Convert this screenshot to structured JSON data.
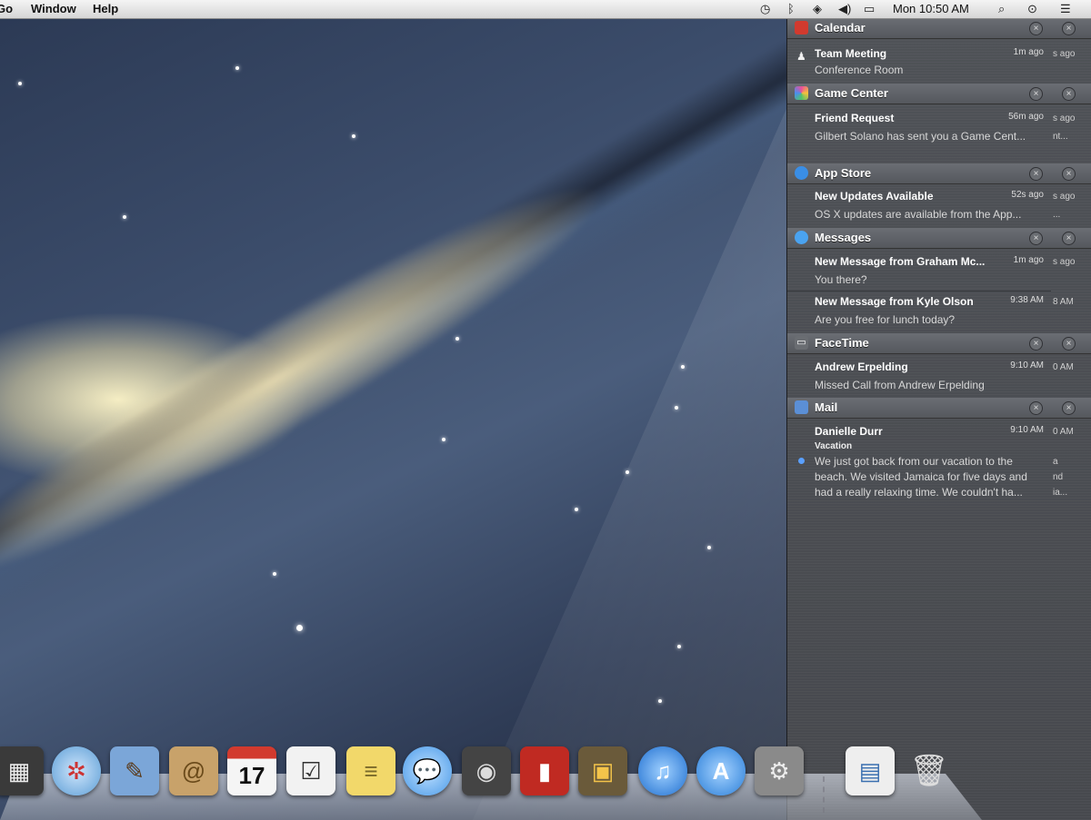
{
  "menubar": {
    "items": [
      "Go",
      "Window",
      "Help"
    ],
    "status_icons": [
      "time-machine-icon",
      "bluetooth-icon",
      "wifi-icon",
      "volume-icon",
      "battery-icon"
    ],
    "clock": "Mon 10:50 AM",
    "right_icons": [
      "spotlight-icon",
      "user-icon",
      "notification-center-icon"
    ]
  },
  "notification_center": {
    "groups": [
      {
        "app": "Calendar",
        "icon": "calendar-icon",
        "icon_color": "#d23a2e",
        "items": [
          {
            "title": "Team Meeting",
            "time": "1m ago",
            "line": "Conference Room",
            "ghost_time": "s ago"
          }
        ]
      },
      {
        "app": "Game Center",
        "icon": "game-center-icon",
        "icon_color": "#e84f9a",
        "items": [
          {
            "title": "Friend Request",
            "time": "56m ago",
            "line": "Gilbert Solano has sent you a Game Cent...",
            "ghost_time": "s ago",
            "ghost_line": "nt..."
          }
        ]
      },
      {
        "app": "App Store",
        "icon": "app-store-icon",
        "icon_color": "#3a8ee6",
        "items": [
          {
            "title": "New Updates Available",
            "time": "52s ago",
            "line": "OS X updates are available from the App...",
            "ghost_time": "s ago",
            "ghost_line": "..."
          }
        ]
      },
      {
        "app": "Messages",
        "icon": "messages-icon",
        "icon_color": "#4aa3f0",
        "items": [
          {
            "title": "New Message from Graham Mc...",
            "time": "1m ago",
            "line": "You there?",
            "ghost_time": "s ago"
          },
          {
            "title": "New Message from Kyle Olson",
            "time": "9:38 AM",
            "line": "Are you free for lunch today?",
            "ghost_time": "8 AM"
          }
        ]
      },
      {
        "app": "FaceTime",
        "icon": "facetime-icon",
        "icon_color": "#6a6d72",
        "items": [
          {
            "title": "Andrew Erpelding",
            "time": "9:10 AM",
            "line": "Missed Call from Andrew Erpelding",
            "ghost_time": "0 AM"
          }
        ]
      },
      {
        "app": "Mail",
        "icon": "mail-icon",
        "icon_color": "#5b8fd6",
        "items": [
          {
            "title": "Danielle Durr",
            "time": "9:10 AM",
            "subject": "Vacation",
            "body": "We just got back from our vacation to the beach.  We visited Jamaica for five days and had a really relaxing time.  We couldn't ha...",
            "ghost_time": "0 AM",
            "ghost_lines": [
              "a",
              "nd",
              "ia..."
            ]
          }
        ]
      }
    ]
  },
  "dock": {
    "icons": [
      {
        "name": "photo-booth-icon",
        "glyph": "▦",
        "bg": "#3a3a3a"
      },
      {
        "name": "safari-icon",
        "glyph": "✲",
        "bg": "#5c9ed6"
      },
      {
        "name": "preview-icon",
        "glyph": "✎",
        "bg": "#7ba6d8"
      },
      {
        "name": "contacts-icon",
        "glyph": "@",
        "bg": "#c8a26a"
      },
      {
        "name": "calendar-icon",
        "glyph": "17",
        "bg": "#f5f5f5"
      },
      {
        "name": "reminders-icon",
        "glyph": "☑",
        "bg": "#f2f2f2"
      },
      {
        "name": "notes-icon",
        "glyph": "≡",
        "bg": "#f2d86a"
      },
      {
        "name": "messages-icon",
        "glyph": "💬",
        "bg": "#6db4f0"
      },
      {
        "name": "facetime-icon",
        "glyph": "◉",
        "bg": "#444"
      },
      {
        "name": "photo-booth-red-icon",
        "glyph": "▮",
        "bg": "#c02a22"
      },
      {
        "name": "iphoto-icon",
        "glyph": "▣",
        "bg": "#6a5a3a"
      },
      {
        "name": "itunes-icon",
        "glyph": "♫",
        "bg": "#2f7ed8"
      },
      {
        "name": "app-store-icon",
        "glyph": "A",
        "bg": "#3b8fe0"
      },
      {
        "name": "system-preferences-icon",
        "glyph": "⚙",
        "bg": "#8a8a8a"
      },
      {
        "name": "document-icon",
        "glyph": "▤",
        "bg": "#eeeeee"
      },
      {
        "name": "trash-icon",
        "glyph": "🗑",
        "bg": "#bdbdbd"
      }
    ],
    "calendar_date": "17"
  }
}
